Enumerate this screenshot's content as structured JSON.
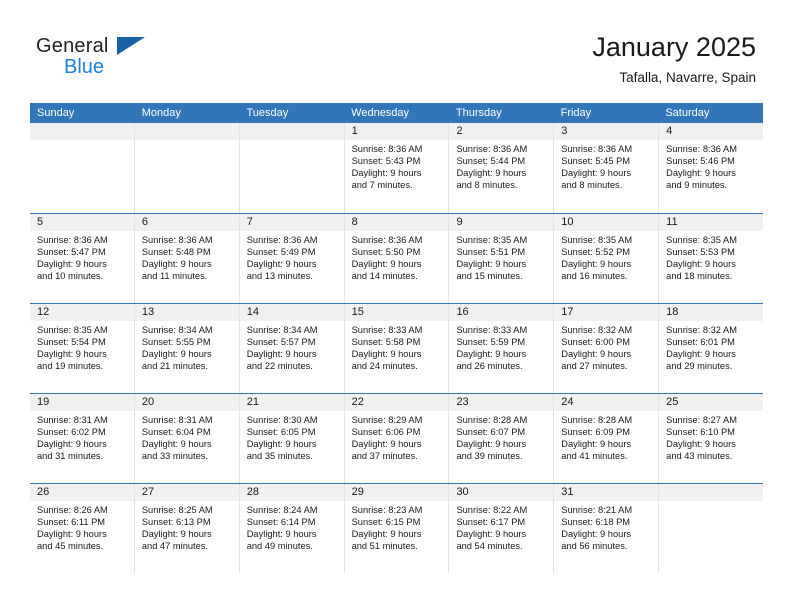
{
  "brand": {
    "name_part1": "General",
    "name_part2": "Blue",
    "triangle_color": "#1464a5",
    "blue_color": "#1e7fd4"
  },
  "header": {
    "title": "January 2025",
    "subtitle": "Tafalla, Navarre, Spain"
  },
  "theme": {
    "header_row_bg": "#3275b8",
    "daynum_band_bg": "#f0f0f0",
    "grid_line": "#e3e3e3",
    "text": "#1a1a1a"
  },
  "calendar": {
    "day_headers": [
      "Sunday",
      "Monday",
      "Tuesday",
      "Wednesday",
      "Thursday",
      "Friday",
      "Saturday"
    ],
    "weeks": [
      [
        {
          "day": "",
          "sunrise": "",
          "sunset": "",
          "daylight1": "",
          "daylight2": "",
          "empty": true
        },
        {
          "day": "",
          "sunrise": "",
          "sunset": "",
          "daylight1": "",
          "daylight2": "",
          "empty": true
        },
        {
          "day": "",
          "sunrise": "",
          "sunset": "",
          "daylight1": "",
          "daylight2": "",
          "empty": true
        },
        {
          "day": "1",
          "sunrise": "Sunrise: 8:36 AM",
          "sunset": "Sunset: 5:43 PM",
          "daylight1": "Daylight: 9 hours",
          "daylight2": "and 7 minutes."
        },
        {
          "day": "2",
          "sunrise": "Sunrise: 8:36 AM",
          "sunset": "Sunset: 5:44 PM",
          "daylight1": "Daylight: 9 hours",
          "daylight2": "and 8 minutes."
        },
        {
          "day": "3",
          "sunrise": "Sunrise: 8:36 AM",
          "sunset": "Sunset: 5:45 PM",
          "daylight1": "Daylight: 9 hours",
          "daylight2": "and 8 minutes."
        },
        {
          "day": "4",
          "sunrise": "Sunrise: 8:36 AM",
          "sunset": "Sunset: 5:46 PM",
          "daylight1": "Daylight: 9 hours",
          "daylight2": "and 9 minutes."
        }
      ],
      [
        {
          "day": "5",
          "sunrise": "Sunrise: 8:36 AM",
          "sunset": "Sunset: 5:47 PM",
          "daylight1": "Daylight: 9 hours",
          "daylight2": "and 10 minutes."
        },
        {
          "day": "6",
          "sunrise": "Sunrise: 8:36 AM",
          "sunset": "Sunset: 5:48 PM",
          "daylight1": "Daylight: 9 hours",
          "daylight2": "and 11 minutes."
        },
        {
          "day": "7",
          "sunrise": "Sunrise: 8:36 AM",
          "sunset": "Sunset: 5:49 PM",
          "daylight1": "Daylight: 9 hours",
          "daylight2": "and 13 minutes."
        },
        {
          "day": "8",
          "sunrise": "Sunrise: 8:36 AM",
          "sunset": "Sunset: 5:50 PM",
          "daylight1": "Daylight: 9 hours",
          "daylight2": "and 14 minutes."
        },
        {
          "day": "9",
          "sunrise": "Sunrise: 8:35 AM",
          "sunset": "Sunset: 5:51 PM",
          "daylight1": "Daylight: 9 hours",
          "daylight2": "and 15 minutes."
        },
        {
          "day": "10",
          "sunrise": "Sunrise: 8:35 AM",
          "sunset": "Sunset: 5:52 PM",
          "daylight1": "Daylight: 9 hours",
          "daylight2": "and 16 minutes."
        },
        {
          "day": "11",
          "sunrise": "Sunrise: 8:35 AM",
          "sunset": "Sunset: 5:53 PM",
          "daylight1": "Daylight: 9 hours",
          "daylight2": "and 18 minutes."
        }
      ],
      [
        {
          "day": "12",
          "sunrise": "Sunrise: 8:35 AM",
          "sunset": "Sunset: 5:54 PM",
          "daylight1": "Daylight: 9 hours",
          "daylight2": "and 19 minutes."
        },
        {
          "day": "13",
          "sunrise": "Sunrise: 8:34 AM",
          "sunset": "Sunset: 5:55 PM",
          "daylight1": "Daylight: 9 hours",
          "daylight2": "and 21 minutes."
        },
        {
          "day": "14",
          "sunrise": "Sunrise: 8:34 AM",
          "sunset": "Sunset: 5:57 PM",
          "daylight1": "Daylight: 9 hours",
          "daylight2": "and 22 minutes."
        },
        {
          "day": "15",
          "sunrise": "Sunrise: 8:33 AM",
          "sunset": "Sunset: 5:58 PM",
          "daylight1": "Daylight: 9 hours",
          "daylight2": "and 24 minutes."
        },
        {
          "day": "16",
          "sunrise": "Sunrise: 8:33 AM",
          "sunset": "Sunset: 5:59 PM",
          "daylight1": "Daylight: 9 hours",
          "daylight2": "and 26 minutes."
        },
        {
          "day": "17",
          "sunrise": "Sunrise: 8:32 AM",
          "sunset": "Sunset: 6:00 PM",
          "daylight1": "Daylight: 9 hours",
          "daylight2": "and 27 minutes."
        },
        {
          "day": "18",
          "sunrise": "Sunrise: 8:32 AM",
          "sunset": "Sunset: 6:01 PM",
          "daylight1": "Daylight: 9 hours",
          "daylight2": "and 29 minutes."
        }
      ],
      [
        {
          "day": "19",
          "sunrise": "Sunrise: 8:31 AM",
          "sunset": "Sunset: 6:02 PM",
          "daylight1": "Daylight: 9 hours",
          "daylight2": "and 31 minutes."
        },
        {
          "day": "20",
          "sunrise": "Sunrise: 8:31 AM",
          "sunset": "Sunset: 6:04 PM",
          "daylight1": "Daylight: 9 hours",
          "daylight2": "and 33 minutes."
        },
        {
          "day": "21",
          "sunrise": "Sunrise: 8:30 AM",
          "sunset": "Sunset: 6:05 PM",
          "daylight1": "Daylight: 9 hours",
          "daylight2": "and 35 minutes."
        },
        {
          "day": "22",
          "sunrise": "Sunrise: 8:29 AM",
          "sunset": "Sunset: 6:06 PM",
          "daylight1": "Daylight: 9 hours",
          "daylight2": "and 37 minutes."
        },
        {
          "day": "23",
          "sunrise": "Sunrise: 8:28 AM",
          "sunset": "Sunset: 6:07 PM",
          "daylight1": "Daylight: 9 hours",
          "daylight2": "and 39 minutes."
        },
        {
          "day": "24",
          "sunrise": "Sunrise: 8:28 AM",
          "sunset": "Sunset: 6:09 PM",
          "daylight1": "Daylight: 9 hours",
          "daylight2": "and 41 minutes."
        },
        {
          "day": "25",
          "sunrise": "Sunrise: 8:27 AM",
          "sunset": "Sunset: 6:10 PM",
          "daylight1": "Daylight: 9 hours",
          "daylight2": "and 43 minutes."
        }
      ],
      [
        {
          "day": "26",
          "sunrise": "Sunrise: 8:26 AM",
          "sunset": "Sunset: 6:11 PM",
          "daylight1": "Daylight: 9 hours",
          "daylight2": "and 45 minutes."
        },
        {
          "day": "27",
          "sunrise": "Sunrise: 8:25 AM",
          "sunset": "Sunset: 6:13 PM",
          "daylight1": "Daylight: 9 hours",
          "daylight2": "and 47 minutes."
        },
        {
          "day": "28",
          "sunrise": "Sunrise: 8:24 AM",
          "sunset": "Sunset: 6:14 PM",
          "daylight1": "Daylight: 9 hours",
          "daylight2": "and 49 minutes."
        },
        {
          "day": "29",
          "sunrise": "Sunrise: 8:23 AM",
          "sunset": "Sunset: 6:15 PM",
          "daylight1": "Daylight: 9 hours",
          "daylight2": "and 51 minutes."
        },
        {
          "day": "30",
          "sunrise": "Sunrise: 8:22 AM",
          "sunset": "Sunset: 6:17 PM",
          "daylight1": "Daylight: 9 hours",
          "daylight2": "and 54 minutes."
        },
        {
          "day": "31",
          "sunrise": "Sunrise: 8:21 AM",
          "sunset": "Sunset: 6:18 PM",
          "daylight1": "Daylight: 9 hours",
          "daylight2": "and 56 minutes."
        },
        {
          "day": "",
          "sunrise": "",
          "sunset": "",
          "daylight1": "",
          "daylight2": "",
          "empty": true
        }
      ]
    ]
  }
}
